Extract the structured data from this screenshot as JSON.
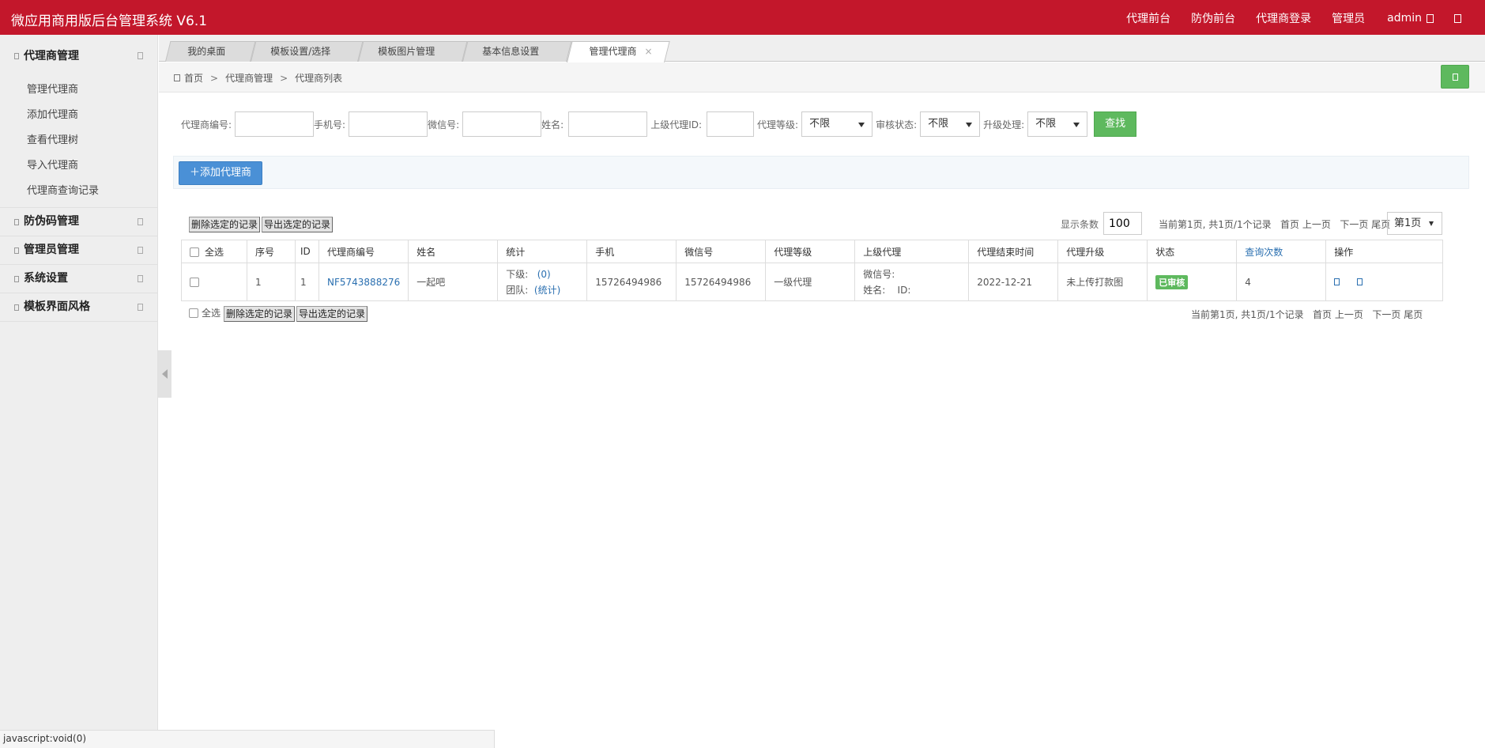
{
  "header": {
    "title": "微应用商用版后台管理系统 V6.1",
    "nav": [
      "代理前台",
      "防伪前台",
      "代理商登录"
    ],
    "admin_label": "管理员",
    "admin_name": "admin"
  },
  "sidebar": {
    "groups": [
      {
        "label": "代理商管理",
        "items": [
          "管理代理商",
          "添加代理商",
          "查看代理树",
          "导入代理商",
          "代理商查询记录"
        ]
      },
      {
        "label": "防伪码管理"
      },
      {
        "label": "管理员管理"
      },
      {
        "label": "系统设置"
      },
      {
        "label": "模板界面风格"
      }
    ]
  },
  "tabs": [
    {
      "label": "我的桌面",
      "close": ""
    },
    {
      "label": "模板设置/选择",
      "close": "×"
    },
    {
      "label": "模板图片管理",
      "close": "×"
    },
    {
      "label": "基本信息设置",
      "close": "×"
    },
    {
      "label": "管理代理商",
      "close": "×"
    }
  ],
  "breadcrumb": {
    "home": "首页",
    "level1": "代理商管理",
    "level2": "代理商列表",
    "sep": ">"
  },
  "search": {
    "agent_no_label": "代理商编号:",
    "phone_label": "手机号:",
    "wechat_label": "微信号:",
    "name_label": "姓名:",
    "parent_id_label": "上级代理ID:",
    "level_label": "代理等级:",
    "level_value": "不限",
    "audit_label": "审核状态:",
    "audit_value": "不限",
    "upgrade_label": "升级处理:",
    "upgrade_value": "不限",
    "submit": "查找"
  },
  "add_button": "添加代理商",
  "toolbar": {
    "delete_selected": "删除选定的记录",
    "export_selected": "导出选定的记录",
    "page_size_label": "显示条数",
    "page_size": "100",
    "page_info": "当前第1页, 共1页/1个记录",
    "first": "首页",
    "prev": "上一页",
    "next": "下一页",
    "last": "尾页",
    "page_select": "第1页"
  },
  "table": {
    "headers": {
      "select_all": "全选",
      "seq": "序号",
      "id": "ID",
      "agent_no": "代理商编号",
      "name": "姓名",
      "stats": "统计",
      "phone": "手机",
      "wechat": "微信号",
      "level": "代理等级",
      "parent": "上级代理",
      "end_time": "代理结束时间",
      "upgrade": "代理升级",
      "status": "状态",
      "query_count": "查询次数",
      "ops": "操作"
    },
    "rows": [
      {
        "seq": "1",
        "id": "1",
        "agent_no": "NF5743888276",
        "name": "一起吧",
        "sub_label": "下级:",
        "sub_value": "(0)",
        "team_label": "团队:",
        "team_value": "(统计)",
        "phone": "15726494986",
        "wechat": "15726494986",
        "level": "一级代理",
        "parent_wechat": "微信号:",
        "parent_name": "姓名:    ID:",
        "end_time": "2022-12-21",
        "upgrade": "未上传打款图",
        "status": "已审核",
        "query_count": "4"
      }
    ]
  },
  "bottom": {
    "select_all": "全选",
    "delete_selected": "删除选定的记录",
    "export_selected": "导出选定的记录"
  },
  "status_bar": "javascript:void(0)"
}
